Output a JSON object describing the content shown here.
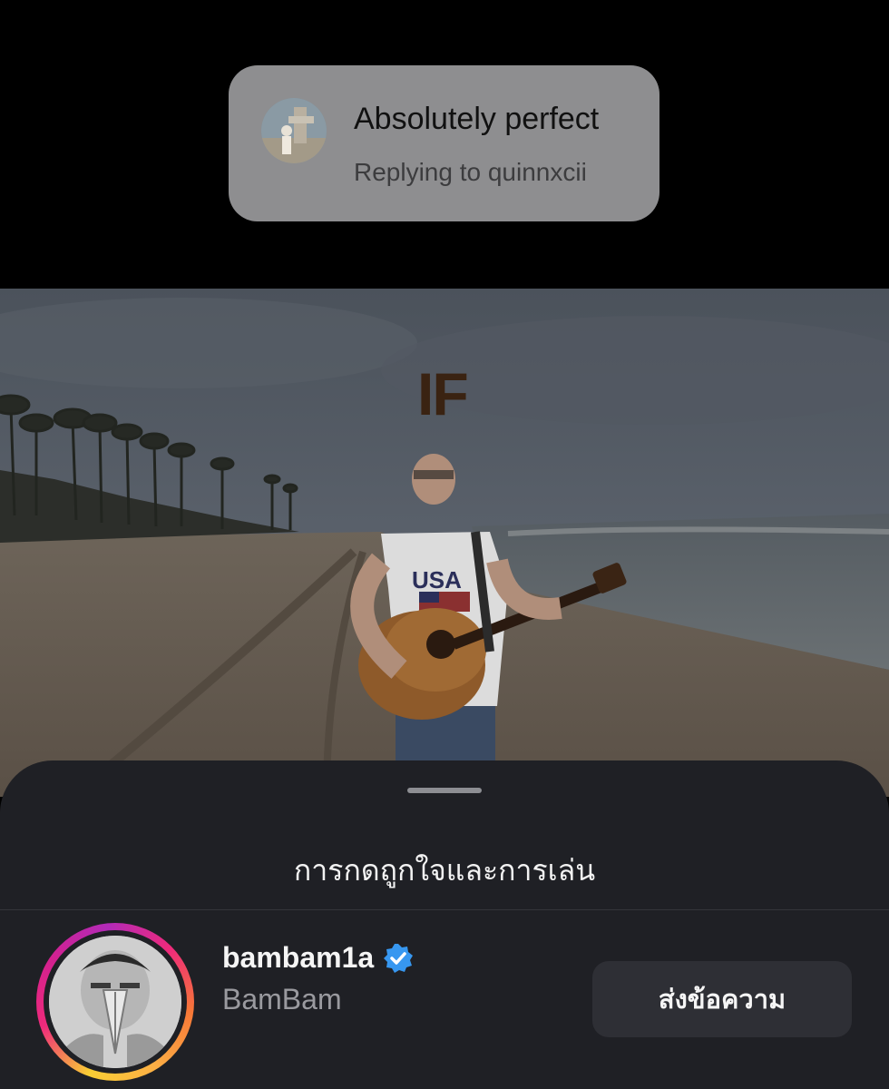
{
  "reply": {
    "message": "Absolutely perfect",
    "subtitle": "Replying to quinnxcii"
  },
  "video": {
    "overlay_title": "IF",
    "shirt_text": "USA"
  },
  "sheet": {
    "title": "การกดถูกใจและการเล่น"
  },
  "user": {
    "username": "bambam1a",
    "display_name": "BamBam",
    "verified": true,
    "message_button": "ส่งข้อความ"
  },
  "colors": {
    "verified_badge": "#3797f0",
    "sheet_bg": "#1f2025",
    "button_bg": "#2e2f35"
  }
}
